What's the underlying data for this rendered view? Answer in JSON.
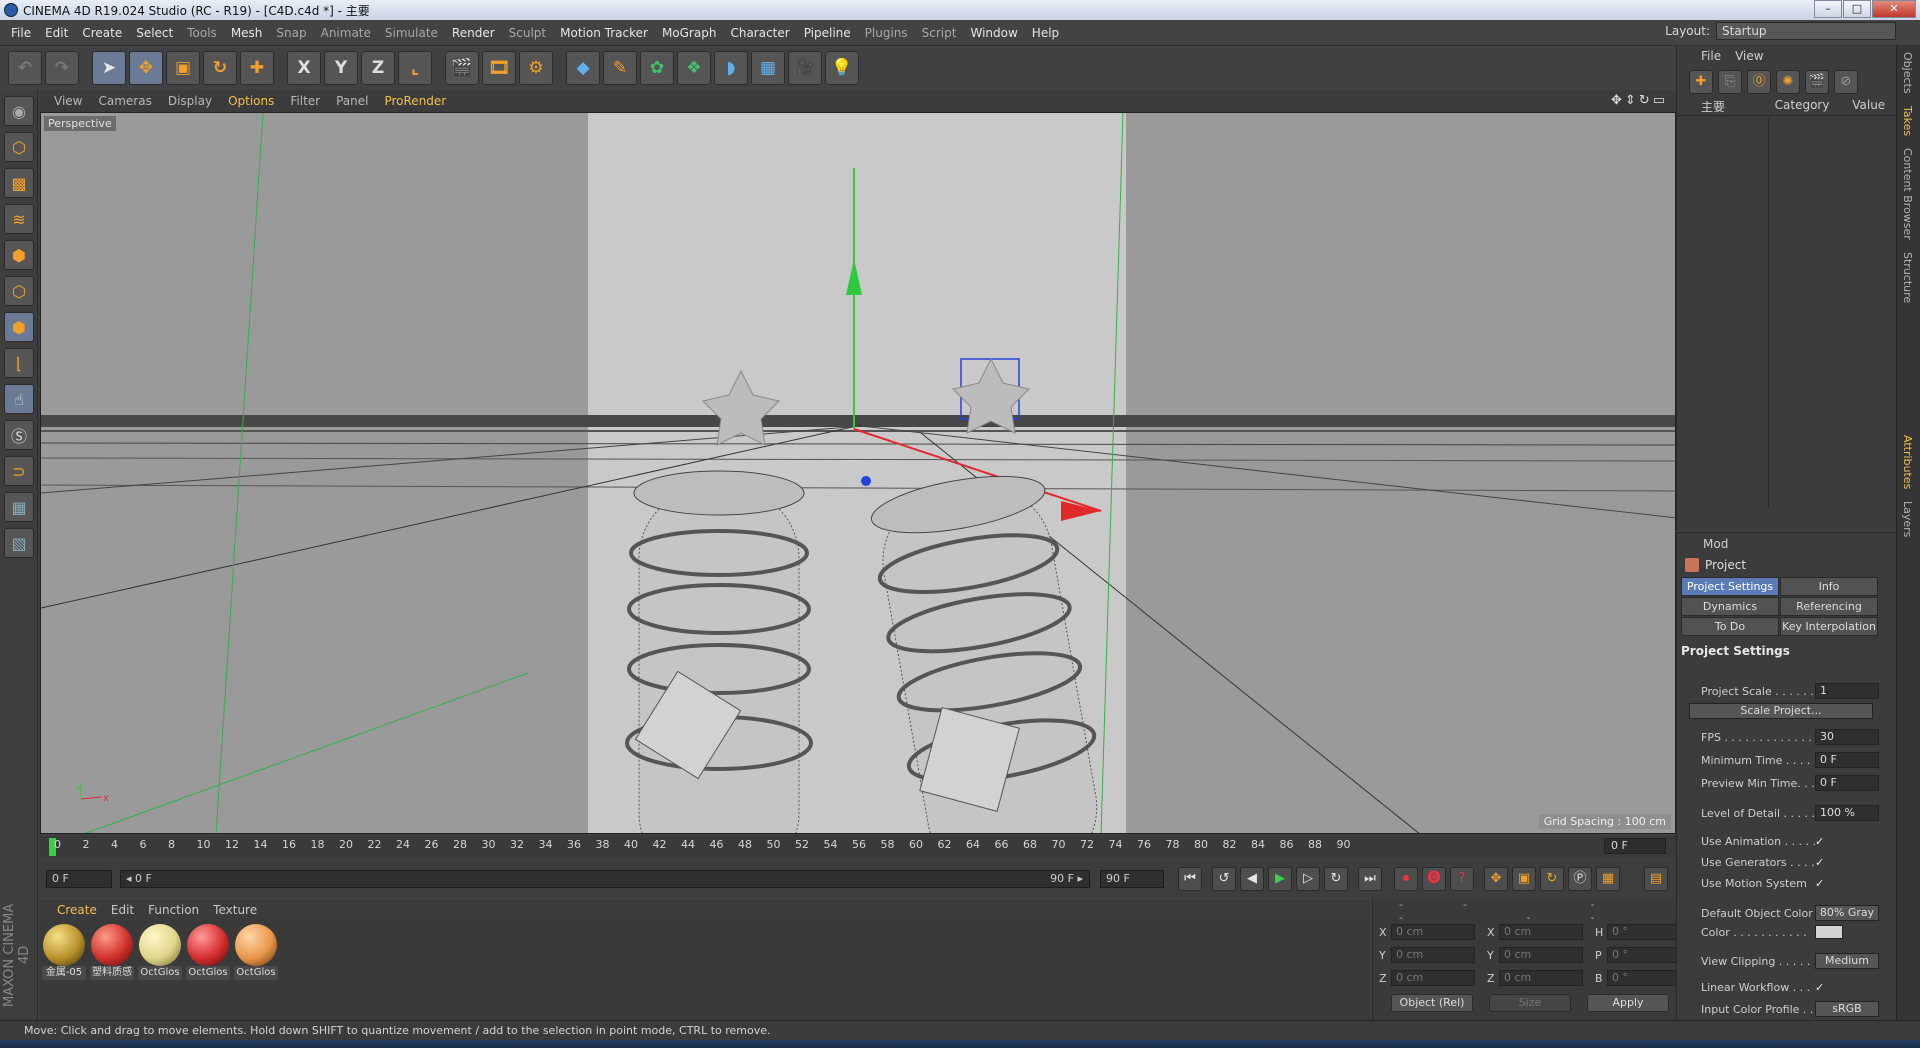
{
  "window": {
    "title": "CINEMA 4D R19.024 Studio (RC - R19) - [C4D.c4d *] - 主要",
    "buttons": {
      "minimize": "–",
      "maximize": "□",
      "close": "✕"
    }
  },
  "menubar": {
    "items": [
      "File",
      "Edit",
      "Create",
      "Select",
      "Tools",
      "Mesh",
      "Snap",
      "Animate",
      "Simulate",
      "Render",
      "Sculpt",
      "Motion Tracker",
      "MoGraph",
      "Character",
      "Pipeline",
      "Plugins",
      "Script",
      "Window",
      "Help"
    ],
    "layout_label": "Layout:",
    "layout_value": "Startup"
  },
  "toolbar": {
    "axis_x": "X",
    "axis_y": "Y",
    "axis_z": "Z"
  },
  "viewport": {
    "menu": [
      "View",
      "Cameras",
      "Display",
      "Options",
      "Filter",
      "Panel",
      "ProRender"
    ],
    "label": "Perspective",
    "grid_spacing": "Grid Spacing : 100 cm",
    "axis_z": "z",
    "axis_x": "x"
  },
  "timeline": {
    "ticks": [
      "0",
      "2",
      "4",
      "6",
      "8",
      "10",
      "12",
      "14",
      "16",
      "18",
      "20",
      "22",
      "24",
      "26",
      "28",
      "30",
      "32",
      "34",
      "36",
      "38",
      "40",
      "42",
      "44",
      "46",
      "48",
      "50",
      "52",
      "54",
      "56",
      "58",
      "60",
      "62",
      "64",
      "66",
      "68",
      "70",
      "72",
      "74",
      "76",
      "78",
      "80",
      "82",
      "84",
      "86",
      "88",
      "90"
    ],
    "end_frame": "0 F",
    "current_frame": "0 F",
    "range_start": "◂ 0 F",
    "range_end": "90 F ▸",
    "max_frame": "90 F"
  },
  "materials": {
    "menu": [
      "Create",
      "Edit",
      "Function",
      "Texture"
    ],
    "items": [
      {
        "label": "金属-05",
        "color": "#b8902a"
      },
      {
        "label": "塑料质感",
        "color": "#d0302a"
      },
      {
        "label": "OctGlos",
        "color": "#e0d48a"
      },
      {
        "label": "OctGlos",
        "color": "#d42d2d"
      },
      {
        "label": "OctGlos",
        "color": "#e89548"
      }
    ]
  },
  "coordinates": {
    "headers": [
      "--",
      "--",
      "--"
    ],
    "rows": [
      {
        "a": "X",
        "av": "0 cm",
        "b": "X",
        "bv": "0 cm",
        "c": "H",
        "cv": "0 °"
      },
      {
        "a": "Y",
        "av": "0 cm",
        "b": "Y",
        "bv": "0 cm",
        "c": "P",
        "cv": "0 °"
      },
      {
        "a": "Z",
        "av": "0 cm",
        "b": "Z",
        "bv": "0 cm",
        "c": "B",
        "cv": "0 °"
      }
    ],
    "mode": "Object (Rel)",
    "size": "Size",
    "apply": "Apply"
  },
  "status": "Move: Click and drag to move elements. Hold down SHIFT to quantize movement / add to the selection in point mode, CTRL to remove.",
  "object_manager": {
    "menu": [
      "File",
      "View"
    ],
    "col_main": "主要",
    "col_category": "Category",
    "col_value": "Value"
  },
  "attributes": {
    "menu": "Mod",
    "project": "Project",
    "tabs": [
      "Project Settings",
      "Info",
      "Dynamics",
      "Referencing",
      "To Do",
      "Key Interpolation"
    ],
    "section": "Project Settings",
    "project_scale_label": "Project Scale . . . . . .",
    "project_scale": "1",
    "scale_project": "Scale Project...",
    "fps_label": "FPS . . . . . . . . . . . . . .",
    "fps": "30",
    "min_time_label": "Minimum Time . . . . .",
    "min_time": "0 F",
    "preview_min_label": "Preview Min Time. . .",
    "preview_min": "0 F",
    "lod_label": "Level of Detail . . . . .",
    "lod": "100 %",
    "use_animation": "Use Animation . . . . .",
    "use_generators": "Use Generators . . . .",
    "use_motion": "Use Motion System",
    "default_color_label": "Default Object Color",
    "default_color": "80% Gray",
    "color_label": "Color . . . . . . . . . . .",
    "view_clipping_label": "View Clipping . . . . .",
    "view_clipping": "Medium",
    "linear_workflow": "Linear Workflow . . .",
    "input_profile_label": "Input Color Profile . .",
    "input_profile": "sRGB",
    "check": "✓"
  },
  "sidetabs": [
    "Objects",
    "Takes",
    "Content Browser",
    "Structure",
    "Attributes",
    "Layers"
  ]
}
